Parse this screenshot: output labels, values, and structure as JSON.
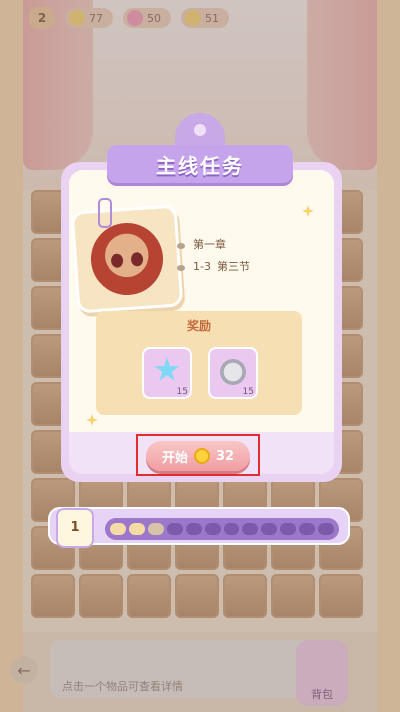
{
  "hud": {
    "level": "2",
    "stat_a": "77",
    "stat_b": "50",
    "stat_c": "51"
  },
  "background": {
    "hint_text": "点击一个物品可查看详情",
    "bag_label": "背包"
  },
  "dialog": {
    "title": "主线任务",
    "chapter": "第一章",
    "section_code": "1-3",
    "section_name": "第三节",
    "rewards_title": "奖励",
    "rewards": [
      {
        "icon": "blue-star-icon",
        "count": "15"
      },
      {
        "icon": "silver-paw-coin-icon",
        "count": "15"
      }
    ],
    "start_label": "开始",
    "start_cost": "32"
  },
  "progress": {
    "day": "1",
    "filled_segments": 2,
    "total_segments": 12
  }
}
